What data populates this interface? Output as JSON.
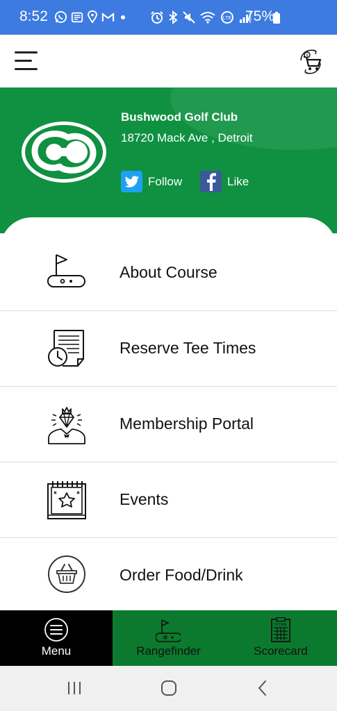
{
  "status_bar": {
    "time": "8:52",
    "battery": "75%",
    "left_icons": [
      "whatsapp-icon",
      "news-icon",
      "location-icon",
      "gmail-icon",
      "dot-icon"
    ],
    "right_icons": [
      "alarm-icon",
      "bluetooth-icon",
      "mute-icon",
      "wifi-icon",
      "volte-icon",
      "signal-icon",
      "battery-icon"
    ]
  },
  "top_bar": {
    "menu_icon": "hamburger-icon",
    "cart_icon": "cart-icon"
  },
  "club": {
    "name": "Bushwood Golf Club",
    "address": "18720 Mack Ave , Detroit",
    "twitter_label": "Follow",
    "facebook_label": "Like"
  },
  "menu_items": [
    {
      "label": "About Course",
      "icon": "golf-flag-icon"
    },
    {
      "label": "Reserve Tee Times",
      "icon": "calendar-clock-icon"
    },
    {
      "label": "Membership Portal",
      "icon": "member-diamond-icon"
    },
    {
      "label": "Events",
      "icon": "events-calendar-icon"
    },
    {
      "label": "Order Food/Drink",
      "icon": "food-basket-icon"
    }
  ],
  "bottom_nav": [
    {
      "label": "Menu",
      "icon": "menu-circle-icon",
      "active": true
    },
    {
      "label": "Rangefinder",
      "icon": "rangefinder-icon",
      "active": false
    },
    {
      "label": "Scorecard",
      "icon": "scorecard-icon",
      "active": false
    }
  ],
  "colors": {
    "status_bar": "#3d7be0",
    "header_green": "#0f9141",
    "nav_green": "#0b7a2f",
    "nav_active": "#000000",
    "twitter": "#1da1f2",
    "facebook": "#3b5998"
  }
}
